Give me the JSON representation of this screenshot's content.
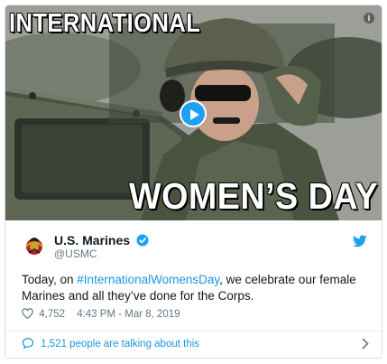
{
  "media": {
    "headline_top": "INTERNATIONAL",
    "headline_bottom": "WOMEN’S DAY",
    "info_icon": "info-icon",
    "play_icon": "play-icon"
  },
  "account": {
    "display_name": "U.S. Marines",
    "handle": "@USMC",
    "verified_icon": "verified-badge-icon",
    "avatar_icon": "usmc-emblem-icon"
  },
  "tweet": {
    "text_before": "Today, on ",
    "hashtag": "#InternationalWomensDay",
    "text_after": ", we celebrate our female Marines and all they’ve done for the Corps."
  },
  "meta": {
    "likes": "4,752",
    "timestamp": "4:43 PM - Mar 8, 2019"
  },
  "footer": {
    "talking_text": "1,521 people are talking about this"
  },
  "colors": {
    "accent": "#1da1f2",
    "link": "#1b95e0",
    "muted": "#657786",
    "text": "#14171a"
  }
}
